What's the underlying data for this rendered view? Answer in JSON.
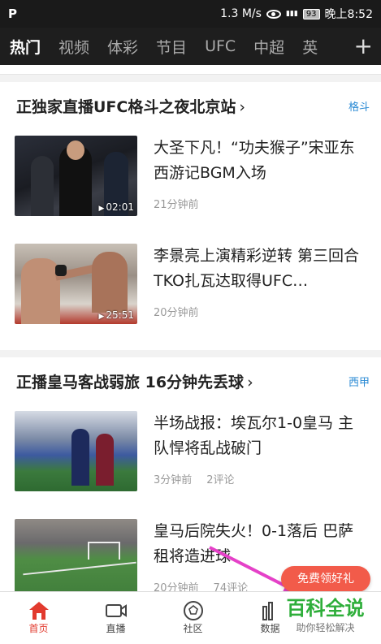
{
  "statusbar": {
    "logo": "P",
    "speed": "1.3 M/s",
    "signal": "4G\n..ll",
    "battery": "93",
    "time": "晚上8:52"
  },
  "nav": {
    "tabs": [
      "热门",
      "视频",
      "体彩",
      "节目",
      "UFC",
      "中超",
      "英"
    ],
    "active": "热门",
    "add_icon": "plus-icon"
  },
  "sections": [
    {
      "title": "正独家直播UFC格斗之夜北京站",
      "tag": "格斗",
      "items": [
        {
          "headline": "大圣下凡！“功夫猴子”宋亚东西游记BGM入场",
          "time": "21分钟前",
          "comments": "",
          "duration": "02:01"
        },
        {
          "headline": "李景亮上演精彩逆转 第三回合TKO扎瓦达取得UFC…",
          "time": "20分钟前",
          "comments": "",
          "duration": "25:51"
        }
      ]
    },
    {
      "title": "正播皇马客战弱旅 16分钟先丢球",
      "tag": "西甲",
      "items": [
        {
          "headline": "半场战报：埃瓦尔1-0皇马 主队悍将乱战破门",
          "time": "3分钟前",
          "comments": "2评论",
          "duration": ""
        },
        {
          "headline": "皇马后院失火！0-1落后 巴萨租将造进球",
          "time": "20分钟前",
          "comments": "74评论",
          "duration": ""
        }
      ]
    }
  ],
  "tabbar": {
    "items": [
      {
        "label": "首页",
        "icon": "home-icon"
      },
      {
        "label": "直播",
        "icon": "video-camera-icon"
      },
      {
        "label": "社区",
        "icon": "ball-icon"
      },
      {
        "label": "数据",
        "icon": "bar-chart-icon"
      }
    ]
  },
  "promo_label": "免费领好礼",
  "watermark": {
    "title": "百科全说",
    "subtitle": "助你轻松解决"
  },
  "colors": {
    "accent": "#e23a2e",
    "tag": "#2a8ad4",
    "promo": "#f25b4a",
    "annotation": "#e541c8"
  }
}
